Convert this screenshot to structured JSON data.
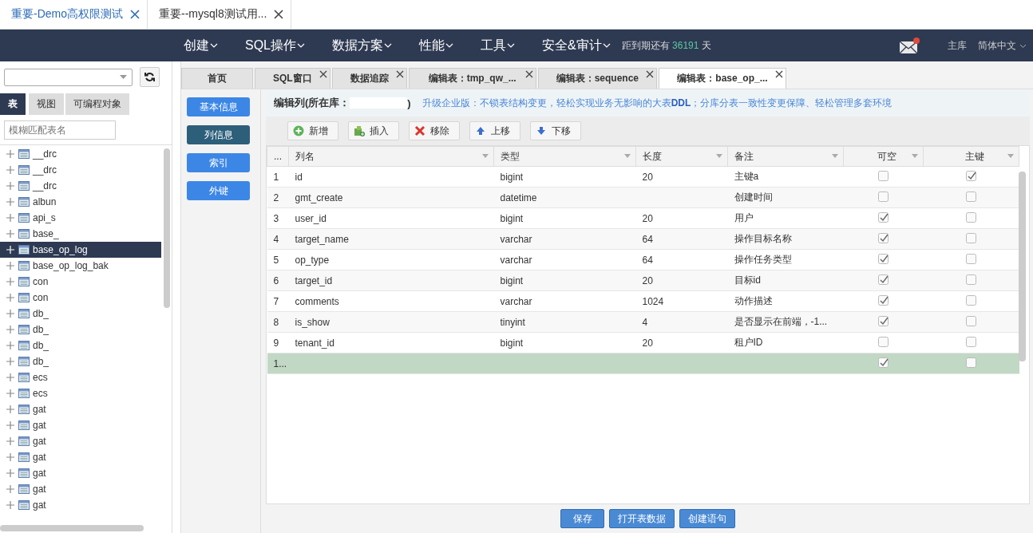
{
  "browser_tabs": [
    {
      "label": "重要-Demo高权限测试",
      "selected": true
    },
    {
      "label": "重要--mysql8测试用...",
      "selected": false
    }
  ],
  "navbar": {
    "menus": [
      "创建",
      "SQL操作",
      "数据方案",
      "性能",
      "工具",
      "安全&审计"
    ],
    "expiry_prefix": "距到期还有",
    "expiry_days": "36191",
    "expiry_suffix": "天",
    "db_role": "主库",
    "language": "简体中文"
  },
  "sidebar": {
    "tabs": [
      {
        "label": "表",
        "selected": true
      },
      {
        "label": "视图",
        "selected": false
      },
      {
        "label": "可编程对象",
        "selected": false
      }
    ],
    "search": {
      "placeholder": "模糊匹配表名"
    },
    "tables": [
      {
        "name": "__drc",
        "selected": false
      },
      {
        "name": "__drc",
        "selected": false
      },
      {
        "name": "__drc",
        "selected": false
      },
      {
        "name": "albun",
        "selected": false
      },
      {
        "name": "api_s",
        "selected": false
      },
      {
        "name": "base_",
        "selected": false
      },
      {
        "name": "base_op_log",
        "selected": true
      },
      {
        "name": "base_op_log_bak",
        "selected": false
      },
      {
        "name": "con",
        "selected": false
      },
      {
        "name": "con",
        "selected": false
      },
      {
        "name": "db_",
        "selected": false
      },
      {
        "name": "db_",
        "selected": false
      },
      {
        "name": "db_",
        "selected": false
      },
      {
        "name": "db_",
        "selected": false
      },
      {
        "name": "ecs",
        "selected": false
      },
      {
        "name": "ecs",
        "selected": false
      },
      {
        "name": "gat",
        "selected": false
      },
      {
        "name": "gat",
        "selected": false
      },
      {
        "name": "gat",
        "selected": false
      },
      {
        "name": "gat",
        "selected": false
      },
      {
        "name": "gat",
        "selected": false
      },
      {
        "name": "gat",
        "selected": false
      },
      {
        "name": "gat",
        "selected": false
      }
    ]
  },
  "editor_tabs": [
    {
      "label": "首页",
      "selected": false,
      "closable": false
    },
    {
      "label": "SQL窗口",
      "selected": false,
      "closable": true
    },
    {
      "label": "数据追踪",
      "selected": false,
      "closable": true
    },
    {
      "label": "编辑表：tmp_qw_...",
      "selected": false,
      "closable": true
    },
    {
      "label": "编辑表：sequence",
      "selected": false,
      "closable": true
    },
    {
      "label": "编辑表：base_op_...",
      "selected": true,
      "closable": true
    }
  ],
  "side_nav": [
    {
      "label": "基本信息",
      "selected": false
    },
    {
      "label": "列信息",
      "selected": true
    },
    {
      "label": "索引",
      "selected": false
    },
    {
      "label": "外键",
      "selected": false
    }
  ],
  "editor": {
    "title_prefix": "编辑列(所在库：",
    "title_suffix": ")",
    "promo": "升级企业版：不锁表结构变更，轻松实现业务无影响的大表**DDL**；分库分表一致性变更保障、轻松管理多套环境",
    "toolbar": [
      {
        "label": "新增",
        "kind": "add"
      },
      {
        "label": "插入",
        "kind": "insert"
      },
      {
        "label": "移除",
        "kind": "remove"
      },
      {
        "label": "上移",
        "kind": "up"
      },
      {
        "label": "下移",
        "kind": "down"
      }
    ]
  },
  "table": {
    "columns": [
      "...",
      "列名",
      "类型",
      "长度",
      "备注",
      "可空",
      "主键"
    ],
    "rows": [
      {
        "no": "1",
        "name": "id",
        "type": "bigint",
        "length": "20",
        "comment": "主键a",
        "nullable": false,
        "primary_key": true,
        "selected": false
      },
      {
        "no": "2",
        "name": "gmt_create",
        "type": "datetime",
        "comment": "创建时间",
        "nullable": false,
        "primary_key": false,
        "selected": false
      },
      {
        "no": "3",
        "name": "user_id",
        "type": "bigint",
        "length": "20",
        "comment": "用户",
        "nullable": true,
        "primary_key": false,
        "selected": false
      },
      {
        "no": "4",
        "name": "target_name",
        "type": "varchar",
        "length": "64",
        "comment": "操作目标名称",
        "nullable": true,
        "primary_key": false,
        "selected": false
      },
      {
        "no": "5",
        "name": "op_type",
        "type": "varchar",
        "length": "64",
        "comment": "操作任务类型",
        "nullable": true,
        "primary_key": false,
        "selected": false
      },
      {
        "no": "6",
        "name": "target_id",
        "type": "bigint",
        "length": "20",
        "comment": "目标id",
        "nullable": true,
        "primary_key": false,
        "selected": false
      },
      {
        "no": "7",
        "name": "comments",
        "type": "varchar",
        "length": "1024",
        "comment": "动作描述",
        "nullable": true,
        "primary_key": false,
        "selected": false
      },
      {
        "no": "8",
        "name": "is_show",
        "type": "tinyint",
        "length": "4",
        "comment": "是否显示在前端，-1...",
        "nullable": true,
        "primary_key": false,
        "selected": false
      },
      {
        "no": "9",
        "name": "tenant_id",
        "type": "bigint",
        "length": "20",
        "comment": "租户ID",
        "nullable": false,
        "primary_key": false,
        "selected": false
      },
      {
        "no": "1...",
        "nullable": true,
        "primary_key": false,
        "selected": true
      }
    ]
  },
  "footer_buttons": [
    "保存",
    "打开表数据",
    "创建语句"
  ]
}
